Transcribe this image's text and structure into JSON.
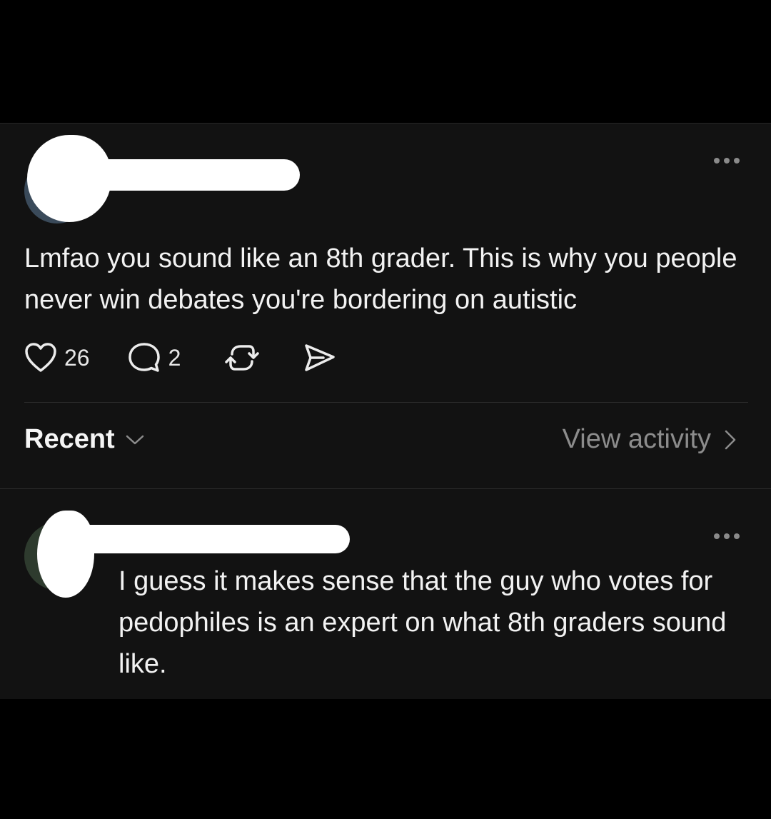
{
  "post": {
    "text": "Lmfao you sound like an 8th grader. This is why you people never win debates you're bordering on autistic",
    "likes": "26",
    "replies": "2",
    "icons": {
      "more": "more-horizontal-icon",
      "like": "heart-icon",
      "reply": "comment-icon",
      "repost": "repost-icon",
      "share": "send-icon"
    }
  },
  "sort": {
    "label": "Recent",
    "view_activity": "View activity"
  },
  "reply": {
    "text": "I guess it makes sense that the guy who votes for pedophiles is an expert on what 8th graders sound like."
  },
  "colors": {
    "background": "#121212",
    "outer": "#000000",
    "text": "#f2f2f2",
    "muted": "#8c8c8c",
    "redaction": "#ffffff"
  }
}
